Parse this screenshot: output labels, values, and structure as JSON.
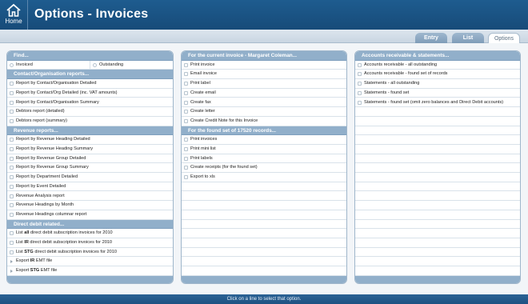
{
  "header": {
    "home_label": "Home",
    "title": "Options - Invoices"
  },
  "tabs": [
    {
      "label": "Entry",
      "active": false
    },
    {
      "label": "List",
      "active": false
    },
    {
      "label": "Options",
      "active": true
    }
  ],
  "panel1": {
    "find_header": "Find...",
    "find_invoiced": "Invoiced",
    "find_outstanding": "Outstanding",
    "contact_header": "Contact/Organisation reports...",
    "contact_items": [
      "Report by Contact/Organisation Detailed",
      "Report by Contact/Org Detailed (inc. VAT amounts)",
      "Report by Contact/Organisation Summary",
      "Debtors report (detailed)",
      "Debtors report (summary)"
    ],
    "revenue_header": "Revenue reports...",
    "revenue_items": [
      "Report by Revenue Heading Detailed",
      "Report by Revenue Heading Summary",
      "Report by Revenue Group Detailed",
      "Report by Revenue Group Summary",
      "Report by Department Detailed",
      "Report by Event Detailed",
      "Revenue Analysis report",
      "Revenue Headings by Month",
      "Revenue Headings columnar report"
    ],
    "dd_header": "Direct debit related...",
    "dd_items": [
      {
        "pre": "List ",
        "bold": "all",
        "post": " direct debit subscription invoices for 2010"
      },
      {
        "pre": "List ",
        "bold": "IR",
        "post": " direct debit subscription invoices for 2010"
      },
      {
        "pre": "List ",
        "bold": "STG",
        "post": " direct debit subscription invoices for 2010"
      },
      {
        "pre": "Export ",
        "bold": "IR",
        "post": " EMT file"
      },
      {
        "pre": "Export ",
        "bold": "STG",
        "post": " EMT file"
      }
    ]
  },
  "panel2": {
    "current_header": "For the current invoice - Margaret Coleman...",
    "current_items": [
      "Print invoice",
      "Email invoice",
      "Print label",
      "Create email",
      "Create fax",
      "Create letter",
      "Create Credit Note for this Invoice"
    ],
    "found_header": "For the found set of 17520 records...",
    "found_items": [
      "Print invoices",
      "Print mini list",
      "Print labels",
      "Create receipts (for the found set)",
      "Export to xls"
    ]
  },
  "panel3": {
    "ar_header": "Accounts receivable & statements...",
    "ar_items": [
      "Accounts receivable - all outstanding",
      "Accounts receivable - found set of records",
      "Statements - all outstanding",
      "Statements - found set",
      "Statements - found set (omit zero balances and Direct Debit accounts)"
    ]
  },
  "status": "Click on a line to select that option."
}
